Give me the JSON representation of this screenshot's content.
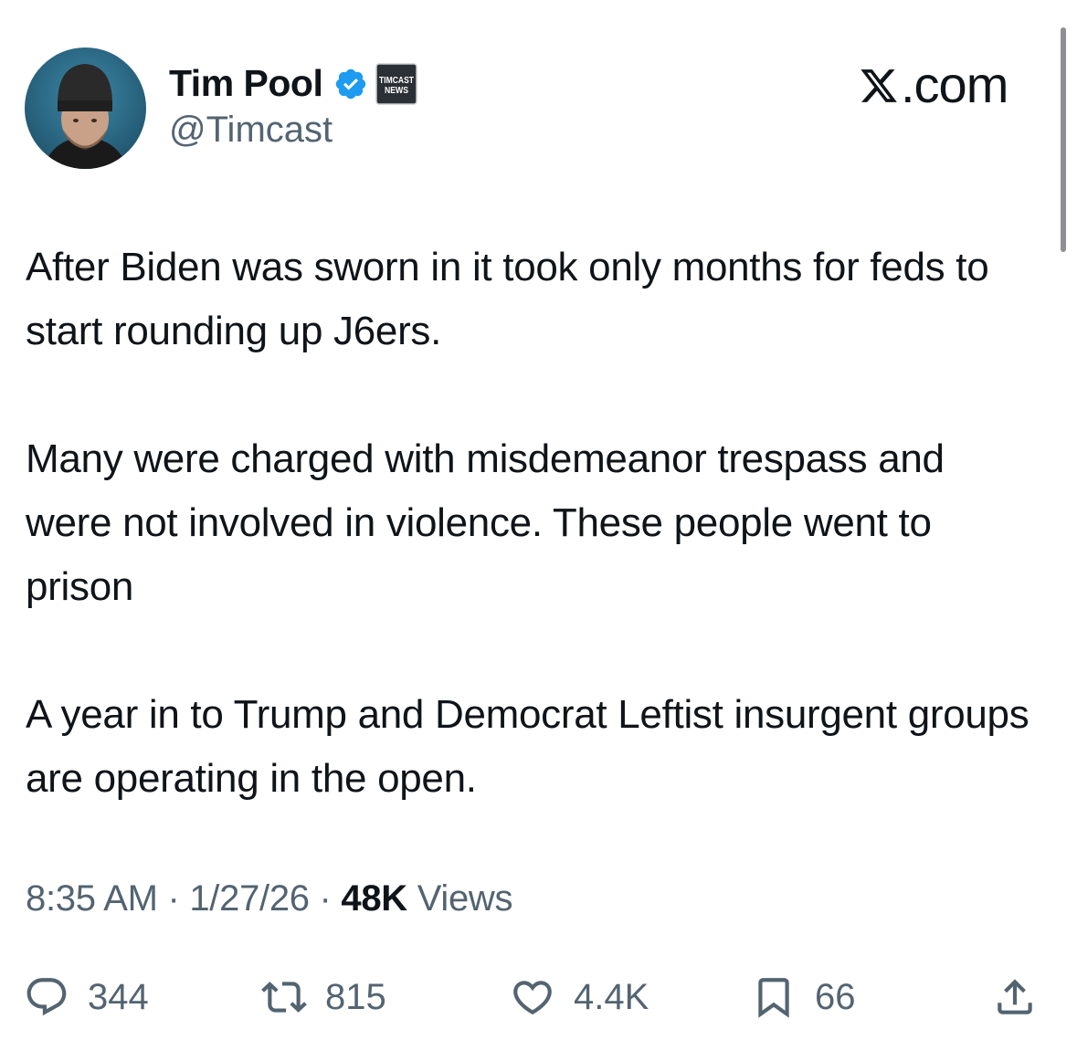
{
  "author": {
    "name": "Tim Pool",
    "handle": "@Timcast",
    "affiliation_badge": "TIMCAST NEWS",
    "verified_color": "#1d9bf0"
  },
  "brand": {
    "label": ".com"
  },
  "tweet": {
    "paragraphs": [
      "After Biden was sworn in it took only months for feds to start rounding up J6ers.",
      "Many were charged with misdemeanor trespass and were not involved in violence. These people went to prison",
      "A year in to Trump and Democrat Leftist insurgent groups are operating in the open."
    ]
  },
  "meta": {
    "time": "8:35 AM",
    "separator": "·",
    "date": "1/27/26",
    "views_count": "48K",
    "views_label": "Views"
  },
  "actions": {
    "replies": "344",
    "reposts": "815",
    "likes": "4.4K",
    "bookmarks": "66"
  }
}
